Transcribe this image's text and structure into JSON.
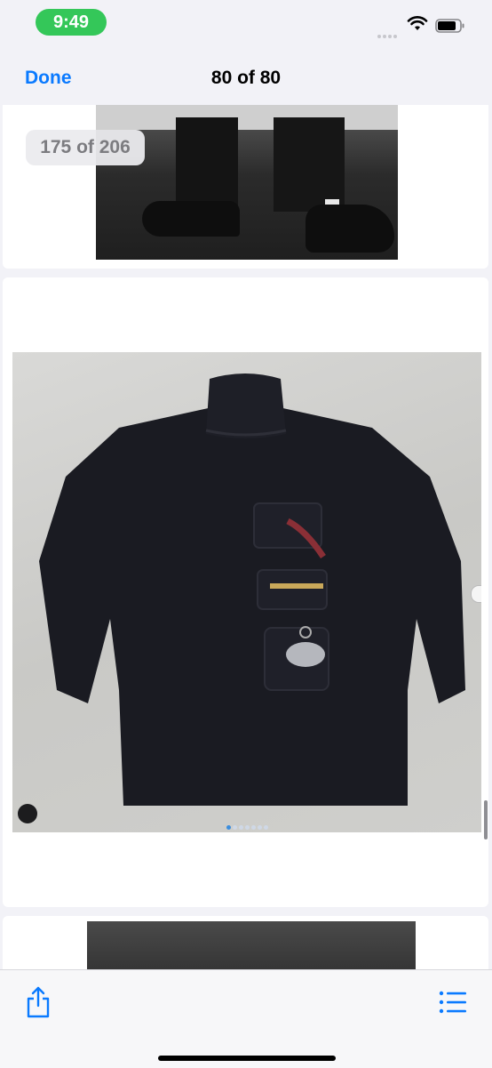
{
  "status": {
    "time": "9:49"
  },
  "nav": {
    "done_label": "Done",
    "title": "80 of 80"
  },
  "viewer": {
    "counter": "175 of 206",
    "carousel_pages": 7,
    "carousel_active": 1
  },
  "colors": {
    "accent": "#0a7aff",
    "time_pill": "#34c759",
    "background": "#f2f2f7"
  },
  "icons": [
    "wifi-icon",
    "battery-icon",
    "share-icon",
    "list-icon",
    "avatar-icon",
    "chevron-right-icon"
  ]
}
